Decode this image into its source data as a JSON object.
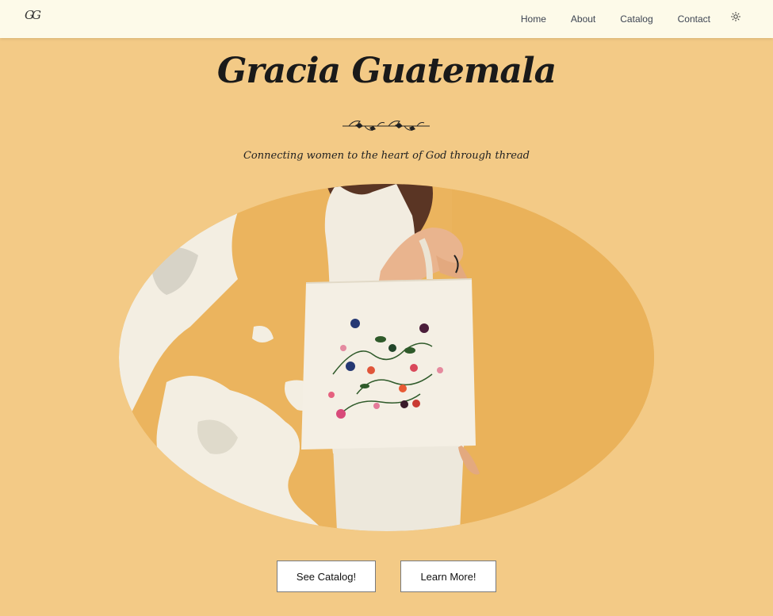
{
  "brand": {
    "logo_text": "GG",
    "title": "Gracia Guatemala",
    "tagline": "Connecting women to the heart of God through thread"
  },
  "nav": {
    "items": [
      {
        "label": "Home"
      },
      {
        "label": "About"
      },
      {
        "label": "Catalog"
      },
      {
        "label": "Contact"
      }
    ],
    "theme_icon": "sun-icon"
  },
  "hero": {
    "image_icon": "photo-woman-with-embroidered-tote-bag"
  },
  "actions": {
    "catalog_label": "See Catalog!",
    "learn_label": "Learn More!"
  },
  "colors": {
    "page_bg": "#f3ca86",
    "nav_bg": "#fdfae9",
    "wall": "#ebb45e"
  }
}
